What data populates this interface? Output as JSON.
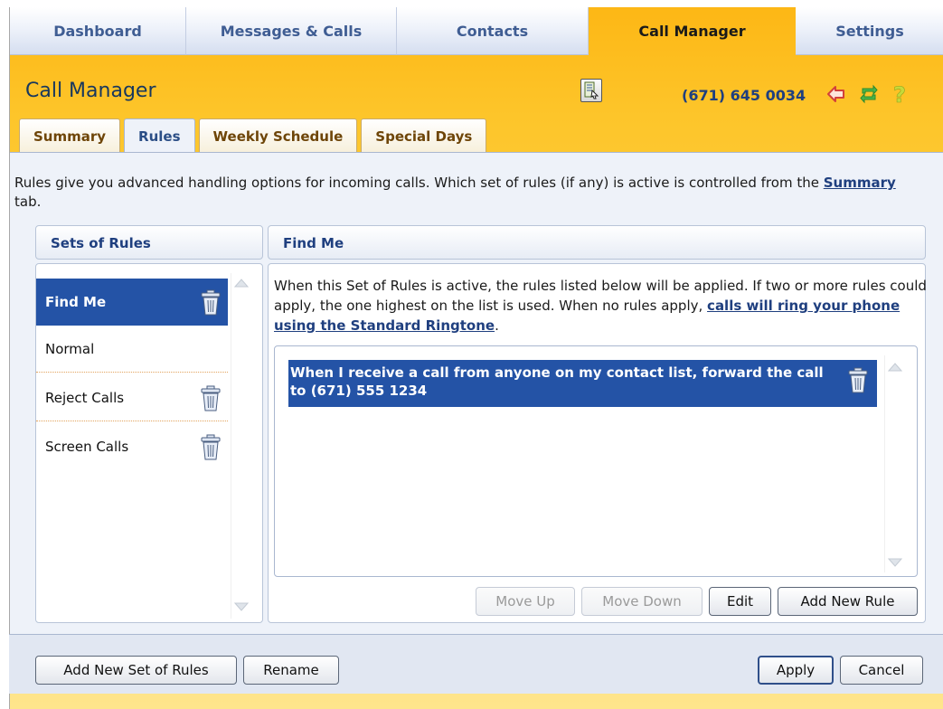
{
  "nav": {
    "tabs": [
      {
        "label": "Dashboard"
      },
      {
        "label": "Messages & Calls"
      },
      {
        "label": "Contacts"
      },
      {
        "label": "Call Manager"
      },
      {
        "label": "Settings"
      }
    ],
    "active": "Call Manager"
  },
  "header": {
    "title": "Call Manager",
    "phone": "(671) 645 0034"
  },
  "subtabs": [
    {
      "label": "Summary"
    },
    {
      "label": "Rules"
    },
    {
      "label": "Weekly Schedule"
    },
    {
      "label": "Special Days"
    }
  ],
  "active_subtab": "Rules",
  "intro": {
    "before": "Rules give you advanced handling options for incoming calls. Which set of rules (if any) is active is controlled from the ",
    "link": "Summary",
    "after": " tab."
  },
  "sets_panel": {
    "header": "Sets of Rules",
    "items": [
      {
        "label": "Find Me",
        "selected": true,
        "deletable": true
      },
      {
        "label": "Normal",
        "selected": false,
        "deletable": false
      },
      {
        "label": "Reject Calls",
        "selected": false,
        "deletable": true
      },
      {
        "label": "Screen Calls",
        "selected": false,
        "deletable": true
      }
    ]
  },
  "rules_panel": {
    "header": "Find Me",
    "description_before": "When this Set of Rules is active, the rules listed below will be applied. If two or more rules could apply, the one highest on the list is used. When no rules apply, ",
    "description_link": "calls will ring your phone using the Standard Ringtone",
    "description_after": ".",
    "rules": [
      {
        "text": "When I receive a call from anyone on my contact list, forward the call to (671) 555 1234",
        "selected": true
      }
    ],
    "buttons": {
      "move_up": "Move Up",
      "move_down": "Move Down",
      "edit": "Edit",
      "add_rule": "Add New Rule"
    }
  },
  "footer": {
    "add_set": "Add New Set of Rules",
    "rename": "Rename",
    "apply": "Apply",
    "cancel": "Cancel"
  },
  "colors": {
    "orange_bg": "#fdb715",
    "selected_blue": "#2453a6",
    "link_blue": "#1f3f7f",
    "panel_bg": "#eef2f9"
  }
}
